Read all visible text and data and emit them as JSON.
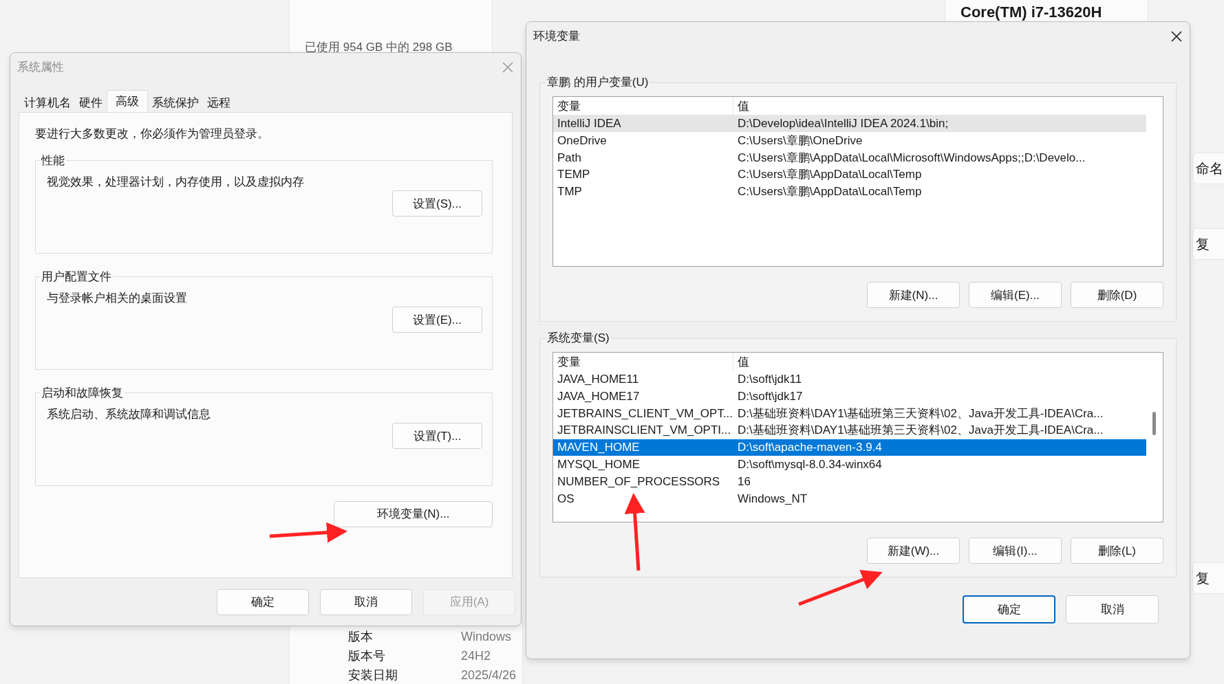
{
  "background_window": {
    "storage_text": "已使用 954 GB 中的 298 GB",
    "processor": "Core(TM) i7-13620H",
    "specs": [
      {
        "label": "版本",
        "value": "Windows"
      },
      {
        "label": "版本号",
        "value": "24H2"
      },
      {
        "label": "安装日期",
        "value": "2025/4/26"
      }
    ],
    "side_labels": [
      "命名",
      "复",
      "复"
    ]
  },
  "system_properties": {
    "title": "系统属性",
    "active": false,
    "tabs": [
      {
        "label": "计算机名",
        "selected": false
      },
      {
        "label": "硬件",
        "selected": false
      },
      {
        "label": "高级",
        "selected": true
      },
      {
        "label": "系统保护",
        "selected": false
      },
      {
        "label": "远程",
        "selected": false
      }
    ],
    "admin_note": "要进行大多数更改，你必须作为管理员登录。",
    "groups": [
      {
        "title": "性能",
        "description": "视觉效果，处理器计划，内存使用，以及虚拟内存",
        "button": "设置(S)..."
      },
      {
        "title": "用户配置文件",
        "description": "与登录帐户相关的桌面设置",
        "button": "设置(E)..."
      },
      {
        "title": "启动和故障恢复",
        "description": "系统启动、系统故障和调试信息",
        "button": "设置(T)..."
      }
    ],
    "env_button": "环境变量(N)...",
    "buttons": [
      {
        "label": "确定",
        "disabled": false
      },
      {
        "label": "取消",
        "disabled": false
      },
      {
        "label": "应用(A)",
        "disabled": true
      }
    ]
  },
  "environment_variables": {
    "title": "环境变量",
    "active": true,
    "lists": [
      {
        "title": "章鹏 的用户变量(U)",
        "focused": false,
        "columns": [
          "变量",
          "值"
        ],
        "rows": [
          {
            "name": "IntelliJ IDEA",
            "value": "D:\\Develop\\idea\\IntelliJ IDEA 2024.1\\bin;",
            "selected": true
          },
          {
            "name": "OneDrive",
            "value": "C:\\Users\\章鹏\\OneDrive",
            "selected": false
          },
          {
            "name": "Path",
            "value": "C:\\Users\\章鹏\\AppData\\Local\\Microsoft\\WindowsApps;;D:\\Develo...",
            "selected": false
          },
          {
            "name": "TEMP",
            "value": "C:\\Users\\章鹏\\AppData\\Local\\Temp",
            "selected": false
          },
          {
            "name": "TMP",
            "value": "C:\\Users\\章鹏\\AppData\\Local\\Temp",
            "selected": false
          }
        ],
        "buttons": [
          "新建(N)...",
          "编辑(E)...",
          "删除(D)"
        ]
      },
      {
        "title": "系统变量(S)",
        "focused": true,
        "columns": [
          "变量",
          "值"
        ],
        "rows": [
          {
            "name": "JAVA_HOME11",
            "value": "D:\\soft\\jdk11",
            "selected": false
          },
          {
            "name": "JAVA_HOME17",
            "value": "D:\\soft\\jdk17",
            "selected": false
          },
          {
            "name": "JETBRAINS_CLIENT_VM_OPT...",
            "value": "D:\\基础班资料\\DAY1\\基础班第三天资料\\02、Java开发工具-IDEA\\Cra...",
            "selected": false
          },
          {
            "name": "JETBRAINSCLIENT_VM_OPTI...",
            "value": "D:\\基础班资料\\DAY1\\基础班第三天资料\\02、Java开发工具-IDEA\\Cra...",
            "selected": false
          },
          {
            "name": "MAVEN_HOME",
            "value": "D:\\soft\\apache-maven-3.9.4",
            "selected": true
          },
          {
            "name": "MYSQL_HOME",
            "value": "D:\\soft\\mysql-8.0.34-winx64",
            "selected": false
          },
          {
            "name": "NUMBER_OF_PROCESSORS",
            "value": "16",
            "selected": false
          },
          {
            "name": "OS",
            "value": "Windows_NT",
            "selected": false
          }
        ],
        "buttons": [
          "新建(W)...",
          "编辑(I)...",
          "删除(L)"
        ]
      }
    ],
    "buttons": [
      {
        "label": "确定",
        "default": true
      },
      {
        "label": "取消",
        "default": false
      }
    ]
  }
}
